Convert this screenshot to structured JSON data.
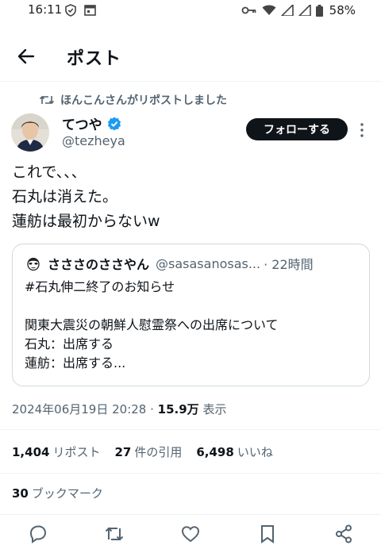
{
  "status_bar": {
    "time": "16:11",
    "battery_percent": "58%"
  },
  "header": {
    "title": "ポスト"
  },
  "repost_note": "ほんこんさんがリポストしました",
  "author": {
    "name": "てつや",
    "handle": "@tezheya",
    "verified": true
  },
  "follow_label": "フォローする",
  "tweet_lines": [
    "これで、、、",
    "石丸は消えた。",
    "蓮舫は最初からないw"
  ],
  "quote": {
    "name": "さささのささやん",
    "handle": "@sasasanosas...",
    "time": "· 22時間",
    "lines": [
      "#石丸伸二終了のお知らせ",
      "",
      "関東大震災の朝鮮人慰霊祭への出席について",
      "石丸：出席する",
      "蓮舫：出席する..."
    ]
  },
  "timestamp": {
    "datetime": "2024年06月19日 20:28 · ",
    "views": "15.9万",
    "views_label": " 表示"
  },
  "stats": {
    "reposts": "1,404",
    "reposts_label": "リポスト",
    "quotes": "27",
    "quotes_label": "件の引用",
    "likes": "6,498",
    "likes_label": "いいね",
    "bookmarks": "30",
    "bookmarks_label": "ブックマーク"
  },
  "colors": {
    "accent_verified": "#1d9bf0",
    "text_primary": "#0f1419",
    "text_secondary": "#536471"
  },
  "icons": [
    "shield-icon",
    "calendar-icon",
    "key-icon",
    "wifi-icon",
    "signal-icon",
    "battery-icon",
    "back-arrow-icon",
    "repost-icon",
    "verified-icon",
    "more-icon",
    "reply-icon",
    "like-icon",
    "bookmark-icon",
    "share-icon"
  ]
}
